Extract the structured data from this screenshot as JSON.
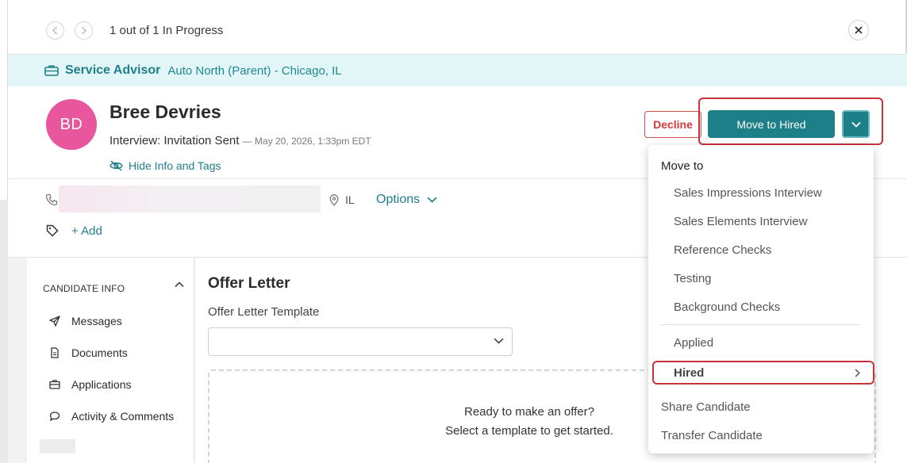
{
  "nav": {
    "counter_text": "1 out of 1 In Progress",
    "prev_icon": "chevron-left-icon",
    "next_icon": "chevron-right-icon",
    "close_icon": "close-icon"
  },
  "job": {
    "title": "Service Advisor",
    "location": "Auto North (Parent) - Chicago, IL",
    "icon": "briefcase-icon"
  },
  "candidate": {
    "initials": "BD",
    "name": "Bree Devries",
    "status": "Interview: Invitation Sent",
    "status_date": "— May 20, 2026, 1:33pm EDT",
    "hide_info_label": "Hide Info and Tags",
    "state": "IL",
    "options_label": "Options",
    "add_tag_label": "+ Add"
  },
  "actions": {
    "decline_label": "Decline",
    "primary_label": "Move to Hired",
    "accent_color": "#1d7f88",
    "decline_color": "#cf3b3b",
    "avatar_color": "#e8579d",
    "highlight_color": "#c9323d"
  },
  "sidebar": {
    "section_title": "CANDIDATE INFO",
    "items": [
      {
        "label": "Messages",
        "icon": "send-icon"
      },
      {
        "label": "Documents",
        "icon": "document-icon"
      },
      {
        "label": "Applications",
        "icon": "briefcase-icon"
      },
      {
        "label": "Activity & Comments",
        "icon": "comment-icon"
      }
    ]
  },
  "offer": {
    "title": "Offer Letter",
    "template_label": "Offer Letter Template",
    "template_value": "",
    "empty_line1": "Ready to make an offer?",
    "empty_line2": "Select a template to get started."
  },
  "menu": {
    "heading": "Move to",
    "stages": [
      "Sales Impressions Interview",
      "Sales Elements Interview",
      "Reference Checks",
      "Testing",
      "Background Checks"
    ],
    "applied": "Applied",
    "hired": "Hired",
    "share": "Share Candidate",
    "transfer": "Transfer Candidate"
  }
}
